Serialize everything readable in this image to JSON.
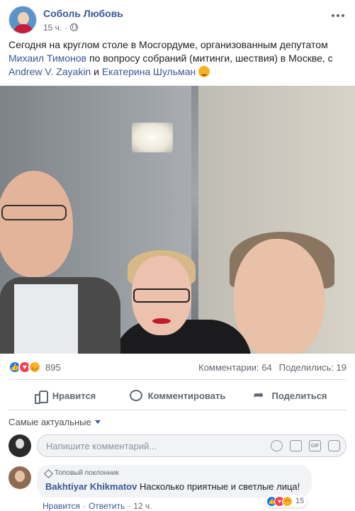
{
  "post": {
    "author": "Соболь Любовь",
    "time": "15 ч.",
    "text_parts": {
      "t1": "Сегодня на круглом столе в Мосгордуме, организованным депутатом ",
      "link1": "Михаил Тимонов",
      "t2": " по вопросу собраний (митинги, шествия) в Москве, с ",
      "link2": "Andrew V. Zayakin",
      "t3": " и ",
      "link3": "Екатерина Шульман",
      "t4": " "
    }
  },
  "stats": {
    "reactions_count": "895",
    "comments": "Комментарии: 64",
    "shares": "Поделились: 19"
  },
  "actions": {
    "like": "Нравится",
    "comment": "Комментировать",
    "share": "Поделиться"
  },
  "comments_section": {
    "sort_label": "Самые актуальные",
    "composer_placeholder": "Напишите комментарий...",
    "gif_label": "GIF"
  },
  "comment": {
    "badge": "Топовый поклонник",
    "author": "Bakhtiyar Khikmatov",
    "text": "Насколько приятные и светлые лица!",
    "like": "Нравится",
    "dot": "·",
    "reply": "Ответить",
    "time": "12 ч.",
    "reactions_count": "15"
  },
  "colors": {
    "link": "#385898",
    "like_blue": "#1877f2",
    "love_red": "#f33e58",
    "haha_yellow": "#f7b125",
    "secondary_text": "#606770"
  }
}
